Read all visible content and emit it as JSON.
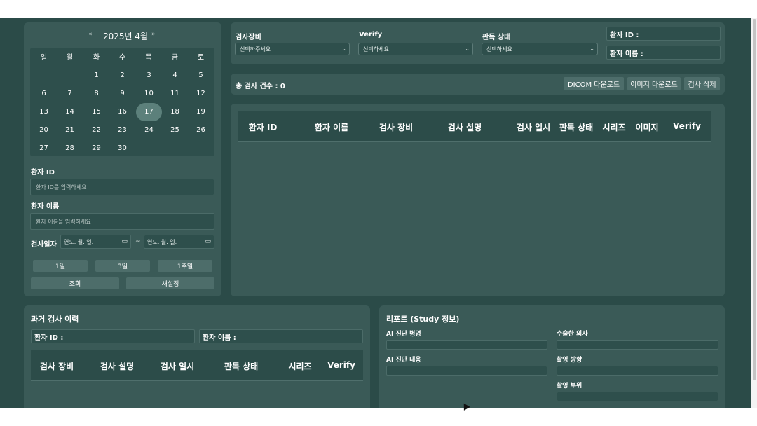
{
  "calendar": {
    "prev": "«",
    "title": "2025년 4월",
    "next": "»",
    "weekdays": [
      "일",
      "월",
      "화",
      "수",
      "목",
      "금",
      "토"
    ],
    "days": [
      "1",
      "2",
      "3",
      "4",
      "5",
      "6",
      "7",
      "8",
      "9",
      "10",
      "11",
      "12",
      "13",
      "14",
      "15",
      "16",
      "17",
      "18",
      "19",
      "20",
      "21",
      "22",
      "23",
      "24",
      "25",
      "26",
      "27",
      "28",
      "29",
      "30"
    ],
    "selected_day": "17"
  },
  "search": {
    "patient_id_label": "환자 ID",
    "patient_id_placeholder": "환자 ID를 입력하세요",
    "patient_name_label": "환자 이름",
    "patient_name_placeholder": "환자 이름을 입력하세요",
    "exam_date_label": "검사일자",
    "date_from": "연도. 월. 일.",
    "date_to": "연도. 월. 일.",
    "date_sep": "~",
    "range_buttons": [
      "1일",
      "3일",
      "1주일"
    ],
    "search_button": "조회",
    "reset_button": "새설정"
  },
  "filters": {
    "device_label": "검사장비",
    "device_value": "선택하주세요",
    "verify_label": "Verify",
    "verify_value": "선택하세요",
    "status_label": "판독 상태",
    "status_value": "선택하세요",
    "patient_id_label": "환자 ID :",
    "patient_name_label": "환자 이름 :"
  },
  "toolbar": {
    "total_label": "총 검사 건수 : 0",
    "dicom_download": "DICOM 다운로드",
    "image_download": "이미지 다운로드",
    "delete_exam": "검사 삭제"
  },
  "main_table": {
    "columns": [
      "환자 ID",
      "환자 이름",
      "검사 장비",
      "검사 설명",
      "검사 일시",
      "판독 상태",
      "시리즈",
      "이미지",
      "Verify"
    ]
  },
  "history": {
    "title": "과거 검사 이력",
    "patient_id_label": "환자 ID :",
    "patient_name_label": "환자 이름 :",
    "columns": [
      "검사 장비",
      "검사 설명",
      "검사 일시",
      "판독 상태",
      "시리즈",
      "Verify"
    ]
  },
  "report": {
    "title": "리포트 (Study 정보)",
    "ai_diagnosis_label": "AI 진단 병명",
    "ai_content_label": "AI 진단 내용",
    "doctor_label": "수술한 의사",
    "direction_label": "촬영 방향",
    "body_part_label": "촬영 부위"
  },
  "colors": {
    "background": "#2b4b48",
    "panel": "#3a5a57",
    "field": "#2e4f4c",
    "button": "#4d6d6a",
    "selected_day": "#5c807b"
  }
}
